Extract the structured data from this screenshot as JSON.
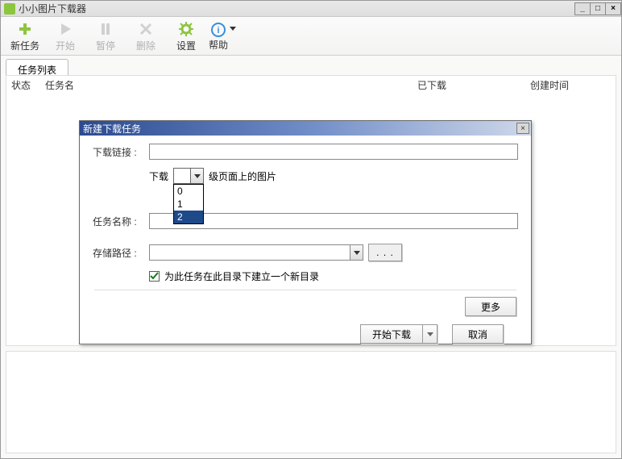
{
  "app": {
    "title": "小小图片下载器"
  },
  "toolbar": {
    "new_task": "新任务",
    "start": "开始",
    "pause": "暂停",
    "delete": "删除",
    "settings": "设置",
    "help": "帮助"
  },
  "tabs": {
    "task_list": "任务列表"
  },
  "list": {
    "header": {
      "status": "状态",
      "name": "任务名",
      "downloaded": "已下载",
      "created": "创建时间"
    }
  },
  "dialog": {
    "title": "新建下载任务",
    "url_label": "下载链接 :",
    "url_value": "",
    "level_prefix": "下载",
    "level_suffix": "级页面上的图片",
    "level_options": [
      "0",
      "1",
      "2"
    ],
    "level_selected": "2",
    "name_label": "任务名称 :",
    "name_value": "",
    "path_label": "存储路径 :",
    "path_value": "",
    "browse_label": ". . .",
    "checkbox_label": "为此任务在此目录下建立一个新目录",
    "checkbox_checked": true,
    "more": "更多",
    "start": "开始下载",
    "cancel": "取消"
  }
}
